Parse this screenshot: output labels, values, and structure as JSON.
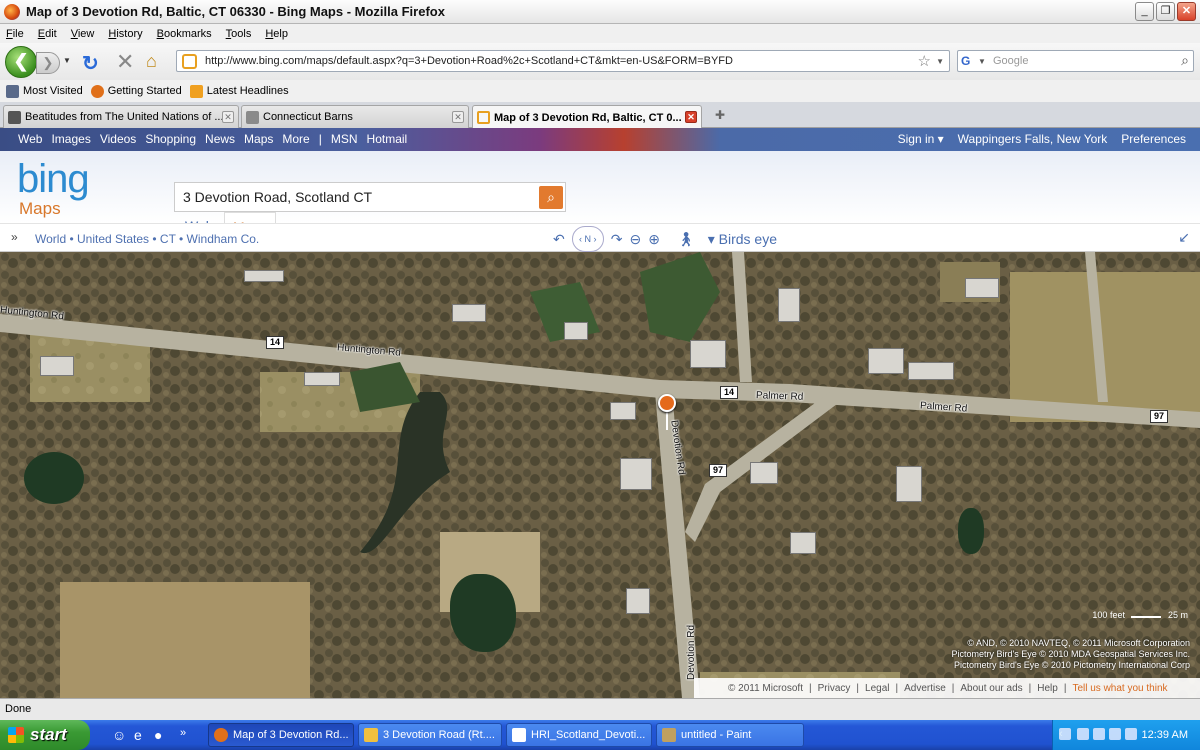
{
  "window": {
    "title": "Map of 3 Devotion Rd, Baltic, CT 06330 - Bing Maps - Mozilla Firefox",
    "buttons": [
      "_",
      "❐",
      "✕"
    ]
  },
  "menu": [
    "File",
    "Edit",
    "View",
    "History",
    "Bookmarks",
    "Tools",
    "Help"
  ],
  "nav": {
    "url": "http://www.bing.com/maps/default.aspx?q=3+Devotion+Road%2c+Scotland+CT&mkt=en-US&FORM=BYFD",
    "search_placeholder": "Google"
  },
  "bookmarks": [
    {
      "label": "Most Visited",
      "color": "#5a6a8a"
    },
    {
      "label": "Getting Started",
      "color": "#e0701a"
    },
    {
      "label": "Latest Headlines",
      "color": "#f0a020"
    }
  ],
  "tabs": [
    {
      "label": "Beatitudes from The United Nations of ...",
      "active": false
    },
    {
      "label": "Connecticut Barns",
      "active": false
    },
    {
      "label": "Map of 3 Devotion Rd, Baltic, CT 0...",
      "active": true
    }
  ],
  "bing": {
    "top_links": [
      "Web",
      "Images",
      "Videos",
      "Shopping",
      "News",
      "Maps",
      "More",
      "|",
      "MSN",
      "Hotmail"
    ],
    "top_right": [
      "Sign in ▾",
      "Wappingers Falls, New York",
      "Preferences"
    ],
    "logo": "bing",
    "logo_sub": "Maps",
    "query": "3 Devotion Road, Scotland CT",
    "tab_web": "Web",
    "tab_maps": "Maps",
    "breadcrumb": "World • United States • CT • Windham Co.",
    "view_mode": "Birds eye",
    "compass_label": "N"
  },
  "map": {
    "roads": [
      {
        "label": "Huntington Rd",
        "where": "top-left"
      },
      {
        "label": "Huntington Rd",
        "where": "center-left"
      },
      {
        "label": "Palmer Rd",
        "where": "center-right"
      },
      {
        "label": "Palmer Rd",
        "where": "right"
      },
      {
        "label": "Devotion Rd",
        "where": "center"
      },
      {
        "label": "Devotion Rd",
        "where": "bottom"
      }
    ],
    "shields": [
      "14",
      "14",
      "97",
      "97"
    ],
    "scale_feet": "100 feet",
    "scale_m": "25 m",
    "credits": [
      "© AND, © 2010 NAVTEQ, © 2011 Microsoft Corporation",
      "Pictometry Bird's Eye © 2010 MDA Geospatial Services Inc.",
      "Pictometry Bird's Eye © 2010 Pictometry International Corp"
    ],
    "footer_links": [
      "© 2011 Microsoft",
      "|",
      "Privacy",
      "|",
      "Legal",
      "|",
      "Advertise",
      "|",
      "About our ads",
      "|",
      "Help",
      "|",
      "Tell us what you think"
    ]
  },
  "status": "Done",
  "taskbar": {
    "start": "start",
    "tasks": [
      {
        "label": "Map of 3 Devotion Rd...",
        "active": true,
        "color": "#e0701a"
      },
      {
        "label": "3 Devotion Road (Rt....",
        "active": false,
        "color": "#f0c040"
      },
      {
        "label": "HRI_Scotland_Devoti...",
        "active": false,
        "color": "#ffffff"
      },
      {
        "label": "untitled - Paint",
        "active": false,
        "color": "#c0a060"
      }
    ],
    "clock": "12:39 AM"
  },
  "colors": {
    "bing_blue": "#2d8bd0",
    "bing_orange": "#d8772a",
    "xp_blue": "#2457d6",
    "start_green": "#3a9a34"
  }
}
